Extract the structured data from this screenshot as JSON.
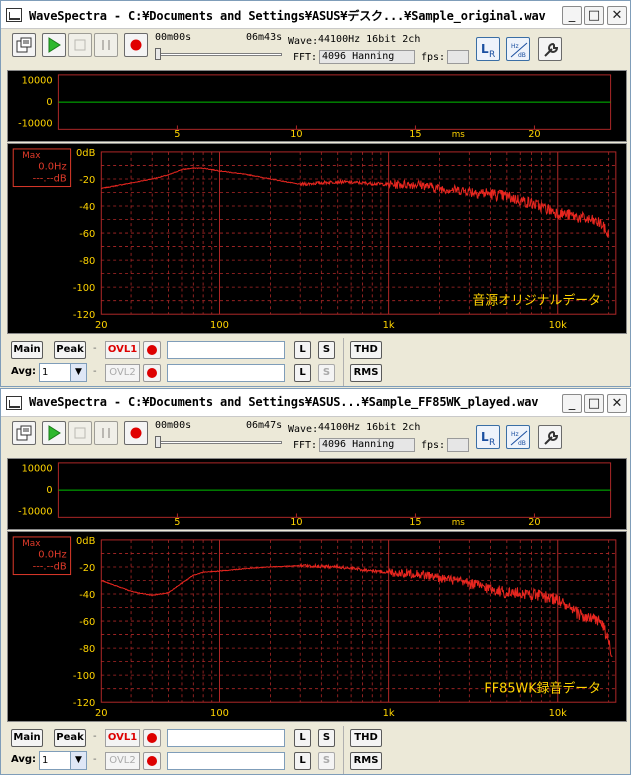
{
  "windows": [
    {
      "title": "WaveSpectra - C:¥Documents and Settings¥ASUS¥デスク...¥Sample_original.wav",
      "time_start": "00m00s",
      "time_end": "06m43s",
      "wave_label": "Wave:",
      "wave_value": "44100Hz 16bit 2ch",
      "fft_label": "FFT:",
      "fft_value": "4096 Hanning",
      "fps_label": "fps:",
      "fps_value": "",
      "scope_y_labels": [
        "10000",
        "0",
        "-10000"
      ],
      "scope_x_labels": [
        "5",
        "10",
        "15",
        "20"
      ],
      "scope_unit": "ms",
      "peak_box": {
        "title": "Max",
        "freq": "0.0Hz",
        "db": "---.--dB"
      },
      "spec_y_labels": [
        "0dB",
        "-20",
        "-40",
        "-60",
        "-80",
        "-100",
        "-120"
      ],
      "spec_x_labels": [
        "20",
        "100",
        "1k",
        "10k"
      ],
      "annotation": "音源オリジナルデータ",
      "controls": {
        "main": "Main",
        "peak": "Peak",
        "dash": "-",
        "ovl1": "OVL1",
        "ovl2": "OVL2",
        "avg_label": "Avg:",
        "avg_value": "1",
        "l": "L",
        "s": "S",
        "thd": "THD",
        "rms": "RMS"
      }
    },
    {
      "title": "WaveSpectra - C:¥Documents and Settings¥ASUS...¥Sample_FF85WK_played.wav",
      "time_start": "00m00s",
      "time_end": "06m47s",
      "wave_label": "Wave:",
      "wave_value": "44100Hz 16bit 2ch",
      "fft_label": "FFT:",
      "fft_value": "4096 Hanning",
      "fps_label": "fps:",
      "fps_value": "",
      "scope_y_labels": [
        "10000",
        "0",
        "-10000"
      ],
      "scope_x_labels": [
        "5",
        "10",
        "15",
        "20"
      ],
      "scope_unit": "ms",
      "peak_box": {
        "title": "Max",
        "freq": "0.0Hz",
        "db": "---.--dB"
      },
      "spec_y_labels": [
        "0dB",
        "-20",
        "-40",
        "-60",
        "-80",
        "-100",
        "-120"
      ],
      "spec_x_labels": [
        "20",
        "100",
        "1k",
        "10k"
      ],
      "annotation": "FF85WK録音データ",
      "controls": {
        "main": "Main",
        "peak": "Peak",
        "dash": "-",
        "ovl1": "OVL1",
        "ovl2": "OVL2",
        "avg_label": "Avg:",
        "avg_value": "1",
        "l": "L",
        "s": "S",
        "thd": "THD",
        "rms": "RMS"
      }
    }
  ],
  "colors": {
    "trace": "#e8261f",
    "grid": "#b02828",
    "scope_line": "#00c000",
    "label": "#ffd400",
    "peak_text": "#e03a2a"
  },
  "icons": [
    "open-file-icon",
    "play-icon",
    "stop-icon",
    "pause-icon",
    "record-icon",
    "lr-icon",
    "hz-db-icon",
    "wrench-icon",
    "minimize-icon",
    "maximize-icon",
    "close-icon"
  ],
  "chart_data": [
    {
      "type": "line",
      "title": "",
      "xlabel": "",
      "ylabel": "",
      "x_scale": "log",
      "xlim": [
        20,
        22050
      ],
      "ylim": [
        -120,
        0
      ],
      "series": [
        {
          "name": "",
          "x": [
            20,
            30,
            40,
            50,
            60,
            70,
            80,
            100,
            150,
            200,
            300,
            500,
            700,
            1000,
            1500,
            2000,
            3000,
            4000,
            5000,
            7000,
            10000,
            12000,
            15000,
            18000,
            20000
          ],
          "values": [
            -27,
            -23,
            -20,
            -17,
            -13,
            -12,
            -12,
            -14,
            -17,
            -20,
            -24,
            -22,
            -23,
            -24,
            -24,
            -27,
            -29,
            -31,
            -33,
            -38,
            -45,
            -47,
            -50,
            -53,
            -62
          ]
        }
      ]
    },
    {
      "type": "line",
      "title": "",
      "xlabel": "",
      "ylabel": "",
      "x_scale": "log",
      "xlim": [
        20,
        22050
      ],
      "ylim": [
        -120,
        0
      ],
      "series": [
        {
          "name": "",
          "x": [
            20,
            30,
            40,
            50,
            60,
            70,
            80,
            100,
            150,
            200,
            300,
            500,
            700,
            1000,
            1500,
            2000,
            3000,
            4000,
            5000,
            7000,
            10000,
            12000,
            15000,
            18000,
            20000,
            21000
          ],
          "values": [
            -30,
            -38,
            -41,
            -39,
            -32,
            -26,
            -24,
            -23,
            -21,
            -20,
            -19,
            -20,
            -22,
            -24,
            -25,
            -28,
            -32,
            -36,
            -39,
            -40,
            -44,
            -52,
            -58,
            -60,
            -75,
            -90
          ]
        }
      ]
    }
  ]
}
